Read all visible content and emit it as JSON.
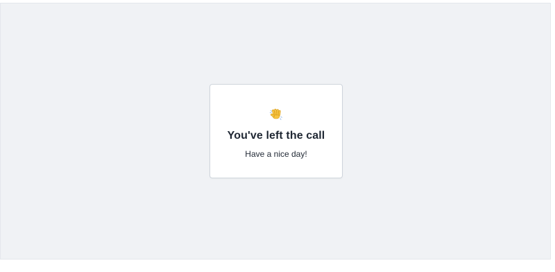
{
  "left_call_screen": {
    "icon": "waving-hand-icon",
    "title": "You've left the call",
    "subtitle": "Have a nice day!"
  },
  "colors": {
    "background": "#f0f2f5",
    "card": "#ffffff",
    "text": "#1f2733",
    "icon": "#f6c544"
  }
}
